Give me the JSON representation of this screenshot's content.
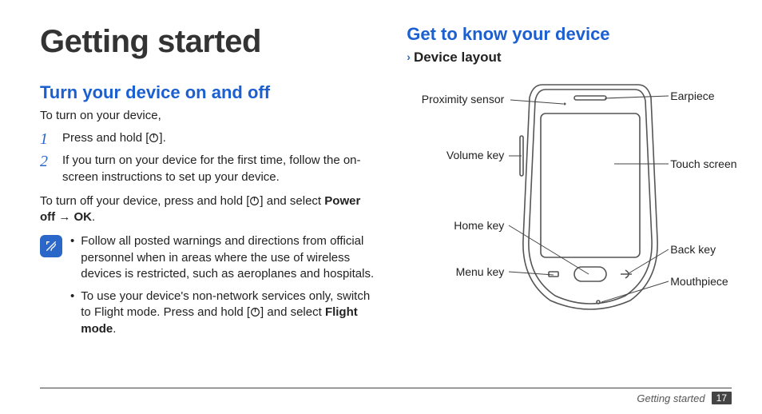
{
  "title": "Getting started",
  "left": {
    "heading": "Turn your device on and off",
    "intro": "To turn on your device,",
    "steps": [
      {
        "pre": "Press and hold [",
        "post": "]."
      },
      {
        "text": "If you turn on your device for the first time, follow the on-screen instructions to set up your device."
      }
    ],
    "turnoff": {
      "pre": "To turn off your device, press and hold [",
      "mid": "] and select ",
      "bold1": "Power off",
      "arrow": " → ",
      "bold2": "OK",
      "end": "."
    },
    "notes": [
      "Follow all posted warnings and directions from official personnel when in areas where the use of wireless devices is restricted, such as aeroplanes and hospitals.",
      {
        "pre": "To use your device's non-network services only, switch to Flight mode. Press and hold [",
        "mid": "] and select ",
        "bold": "Flight mode",
        "end": "."
      }
    ]
  },
  "right": {
    "heading": "Get to know your device",
    "sub": "Device layout",
    "labels": {
      "proximity": "Proximity sensor",
      "earpiece": "Earpiece",
      "volume": "Volume key",
      "touch": "Touch screen",
      "home": "Home key",
      "back": "Back key",
      "menu": "Menu key",
      "mouth": "Mouthpiece"
    }
  },
  "footer": {
    "section": "Getting started",
    "page": "17"
  }
}
